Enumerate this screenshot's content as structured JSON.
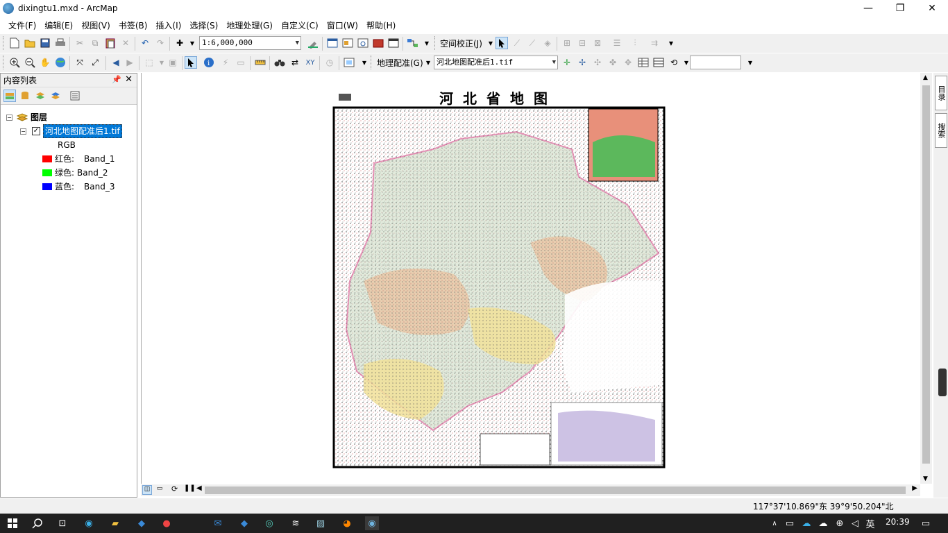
{
  "window": {
    "title": "dixingtu1.mxd - ArcMap",
    "minimize": "—",
    "maximize": "❐",
    "close": "✕"
  },
  "menu": [
    "文件(F)",
    "编辑(E)",
    "视图(V)",
    "书签(B)",
    "插入(I)",
    "选择(S)",
    "地理处理(G)",
    "自定义(C)",
    "窗口(W)",
    "帮助(H)"
  ],
  "toolbar1": {
    "scale": "1:6,000,000",
    "spatial_adjust": "空间校正(J)"
  },
  "toolbar2": {
    "georef_label": "地理配准(G)",
    "georef_layer": "河北地图配准后1.tif",
    "search_value": ""
  },
  "toc": {
    "title": "内容列表",
    "layers_label": "图层",
    "layer_name": "河北地图配准后1.tif",
    "rgb_label": "RGB",
    "bands": [
      {
        "label": "红色:",
        "band": "Band_1",
        "color": "#ff0000"
      },
      {
        "label": "绿色:",
        "band": "Band_2",
        "color": "#00ff00"
      },
      {
        "label": "蓝色:",
        "band": "Band_3",
        "color": "#0000ff"
      }
    ]
  },
  "map": {
    "title": "河北省地图"
  },
  "sidebar": {
    "catalog": "目录",
    "search": "搜索"
  },
  "status": {
    "coords": "117°37'10.869\"东  39°9'50.204\"北"
  },
  "taskbar": {
    "ime": "英",
    "time": "20:39"
  }
}
